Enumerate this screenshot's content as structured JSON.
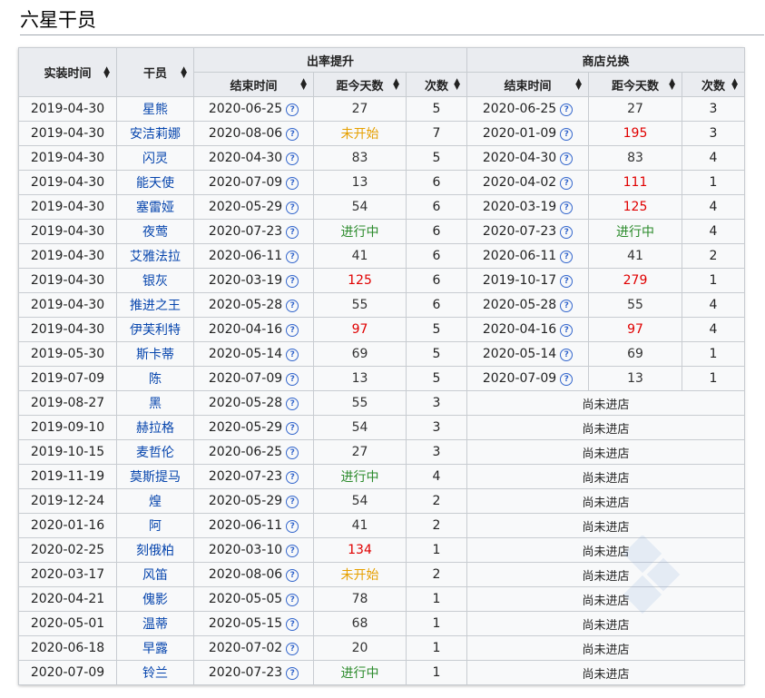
{
  "title": "六星干员",
  "headers": {
    "release_time": "实装时间",
    "operator": "干员",
    "rateup_group": "出率提升",
    "shop_group": "商店兑换",
    "end_time": "结束时间",
    "days_since": "距今天数",
    "count": "次数"
  },
  "not_in_shop": "尚未进店",
  "rows": [
    {
      "release": "2019-04-30",
      "name": "星熊",
      "r_end": "2020-06-25",
      "r_days": "27",
      "r_days_style": "norm",
      "r_count": "5",
      "s_end": "2020-06-25",
      "s_days": "27",
      "s_days_style": "norm",
      "s_count": "3"
    },
    {
      "release": "2019-04-30",
      "name": "安洁莉娜",
      "r_end": "2020-08-06",
      "r_days": "未开始",
      "r_days_style": "orange",
      "r_count": "7",
      "s_end": "2020-01-09",
      "s_days": "195",
      "s_days_style": "red",
      "s_count": "3"
    },
    {
      "release": "2019-04-30",
      "name": "闪灵",
      "r_end": "2020-04-30",
      "r_days": "83",
      "r_days_style": "norm",
      "r_count": "5",
      "s_end": "2020-04-30",
      "s_days": "83",
      "s_days_style": "norm",
      "s_count": "4"
    },
    {
      "release": "2019-04-30",
      "name": "能天使",
      "r_end": "2020-07-09",
      "r_days": "13",
      "r_days_style": "norm",
      "r_count": "6",
      "s_end": "2020-04-02",
      "s_days": "111",
      "s_days_style": "red",
      "s_count": "1"
    },
    {
      "release": "2019-04-30",
      "name": "塞雷娅",
      "r_end": "2020-05-29",
      "r_days": "54",
      "r_days_style": "norm",
      "r_count": "6",
      "s_end": "2020-03-19",
      "s_days": "125",
      "s_days_style": "red",
      "s_count": "4"
    },
    {
      "release": "2019-04-30",
      "name": "夜莺",
      "r_end": "2020-07-23",
      "r_days": "进行中",
      "r_days_style": "green",
      "r_count": "6",
      "s_end": "2020-07-23",
      "s_days": "进行中",
      "s_days_style": "green",
      "s_count": "4"
    },
    {
      "release": "2019-04-30",
      "name": "艾雅法拉",
      "r_end": "2020-06-11",
      "r_days": "41",
      "r_days_style": "norm",
      "r_count": "6",
      "s_end": "2020-06-11",
      "s_days": "41",
      "s_days_style": "norm",
      "s_count": "2"
    },
    {
      "release": "2019-04-30",
      "name": "银灰",
      "r_end": "2020-03-19",
      "r_days": "125",
      "r_days_style": "red",
      "r_count": "6",
      "s_end": "2019-10-17",
      "s_days": "279",
      "s_days_style": "red",
      "s_count": "1"
    },
    {
      "release": "2019-04-30",
      "name": "推进之王",
      "r_end": "2020-05-28",
      "r_days": "55",
      "r_days_style": "norm",
      "r_count": "6",
      "s_end": "2020-05-28",
      "s_days": "55",
      "s_days_style": "norm",
      "s_count": "4"
    },
    {
      "release": "2019-04-30",
      "name": "伊芙利特",
      "r_end": "2020-04-16",
      "r_days": "97",
      "r_days_style": "red",
      "r_count": "5",
      "s_end": "2020-04-16",
      "s_days": "97",
      "s_days_style": "red",
      "s_count": "4"
    },
    {
      "release": "2019-05-30",
      "name": "斯卡蒂",
      "r_end": "2020-05-14",
      "r_days": "69",
      "r_days_style": "norm",
      "r_count": "5",
      "s_end": "2020-05-14",
      "s_days": "69",
      "s_days_style": "norm",
      "s_count": "1"
    },
    {
      "release": "2019-07-09",
      "name": "陈",
      "r_end": "2020-07-09",
      "r_days": "13",
      "r_days_style": "norm",
      "r_count": "5",
      "s_end": "2020-07-09",
      "s_days": "13",
      "s_days_style": "norm",
      "s_count": "1"
    },
    {
      "release": "2019-08-27",
      "name": "黑",
      "r_end": "2020-05-28",
      "r_days": "55",
      "r_days_style": "norm",
      "r_count": "3",
      "shop": false
    },
    {
      "release": "2019-09-10",
      "name": "赫拉格",
      "r_end": "2020-05-29",
      "r_days": "54",
      "r_days_style": "norm",
      "r_count": "3",
      "shop": false
    },
    {
      "release": "2019-10-15",
      "name": "麦哲伦",
      "r_end": "2020-06-25",
      "r_days": "27",
      "r_days_style": "norm",
      "r_count": "3",
      "shop": false
    },
    {
      "release": "2019-11-19",
      "name": "莫斯提马",
      "r_end": "2020-07-23",
      "r_days": "进行中",
      "r_days_style": "green",
      "r_count": "4",
      "shop": false
    },
    {
      "release": "2019-12-24",
      "name": "煌",
      "r_end": "2020-05-29",
      "r_days": "54",
      "r_days_style": "norm",
      "r_count": "2",
      "shop": false
    },
    {
      "release": "2020-01-16",
      "name": "阿",
      "r_end": "2020-06-11",
      "r_days": "41",
      "r_days_style": "norm",
      "r_count": "2",
      "shop": false
    },
    {
      "release": "2020-02-25",
      "name": "刻俄柏",
      "r_end": "2020-03-10",
      "r_days": "134",
      "r_days_style": "red",
      "r_count": "1",
      "shop": false
    },
    {
      "release": "2020-03-17",
      "name": "风笛",
      "r_end": "2020-08-06",
      "r_days": "未开始",
      "r_days_style": "orange",
      "r_count": "2",
      "shop": false
    },
    {
      "release": "2020-04-21",
      "name": "傀影",
      "r_end": "2020-05-05",
      "r_days": "78",
      "r_days_style": "norm",
      "r_count": "1",
      "shop": false
    },
    {
      "release": "2020-05-01",
      "name": "温蒂",
      "r_end": "2020-05-15",
      "r_days": "68",
      "r_days_style": "norm",
      "r_count": "1",
      "shop": false
    },
    {
      "release": "2020-06-18",
      "name": "早露",
      "r_end": "2020-07-02",
      "r_days": "20",
      "r_days_style": "norm",
      "r_count": "1",
      "shop": false
    },
    {
      "release": "2020-07-09",
      "name": "铃兰",
      "r_end": "2020-07-23",
      "r_days": "进行中",
      "r_days_style": "green",
      "r_count": "1",
      "shop": false
    }
  ],
  "colors": {
    "link": "#0645ad",
    "not_started": "#e6a000",
    "overdue": "#e00000",
    "ongoing": "#2a8a2a",
    "header_bg": "#eaecf0",
    "cell_bg": "#f8f9fa"
  },
  "icons": {
    "sort": "sort-arrows-icon",
    "help": "question-circle-icon"
  }
}
